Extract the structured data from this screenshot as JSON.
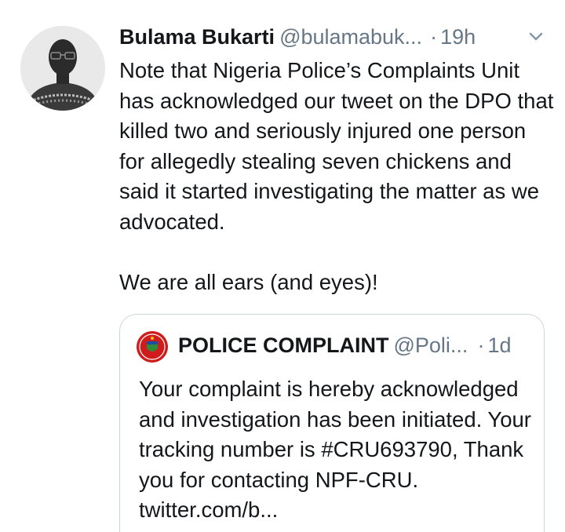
{
  "tweet": {
    "author_name": "Bulama Bukarti",
    "author_handle": "@bulamabuk...",
    "separator": "·",
    "time": "19h",
    "avatar_icon": "user-avatar-icon",
    "menu_icon": "chevron-down-icon",
    "paragraph1": "Note that Nigeria Police’s Complaints Unit has acknowledged our tweet on the DPO that killed two and seriously injured one person for allegedly stealing seven chickens and said it started investigating the matter as we advocated.",
    "paragraph2": "We are all ears (and eyes)!"
  },
  "quote": {
    "author_name": "POLICE COMPLAINT",
    "author_handle": "@Poli...",
    "separator": "·",
    "time": "1d",
    "avatar_icon": "police-logo-icon",
    "text": "Your complaint is hereby acknowledged and investigation has been initiated. Your tracking number is #CRU693790, Thank you for contacting NPF-CRU. twitter.com/b..."
  },
  "colors": {
    "text_primary": "#14171a",
    "text_secondary": "#657786",
    "border": "#ccd6dd",
    "police_red": "#d01c1c"
  }
}
